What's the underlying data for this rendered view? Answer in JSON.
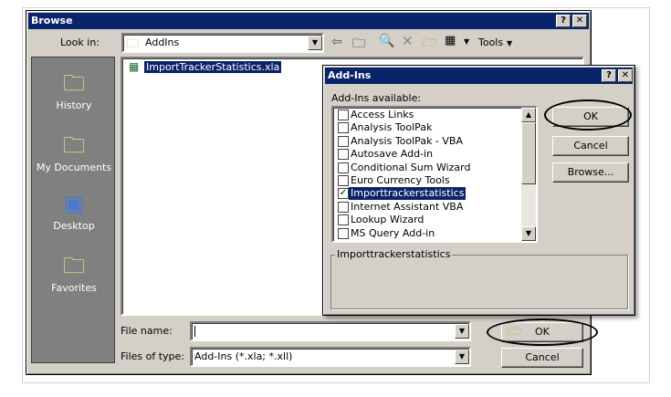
{
  "browse": {
    "title": "Browse",
    "help": "?",
    "close": "✕",
    "look_in_label": "Look in:",
    "look_in_value": "AddIns",
    "tools_label": "Tools",
    "places": [
      {
        "label": "History"
      },
      {
        "label": "My Documents"
      },
      {
        "label": "Desktop"
      },
      {
        "label": "Favorites"
      }
    ],
    "file": "ImportTrackerStatistics.xla",
    "filename_label": "File name:",
    "filename_value": "",
    "filetype_label": "Files of type:",
    "filetype_value": "Add-Ins (*.xla; *.xll)",
    "ok_label": "OK",
    "cancel_label": "Cancel"
  },
  "addins": {
    "title": "Add-Ins",
    "available_label": "Add-Ins available:",
    "items": [
      {
        "label": "Access Links",
        "checked": false
      },
      {
        "label": "Analysis ToolPak",
        "checked": false
      },
      {
        "label": "Analysis ToolPak - VBA",
        "checked": false
      },
      {
        "label": "Autosave Add-in",
        "checked": false
      },
      {
        "label": "Conditional Sum Wizard",
        "checked": false
      },
      {
        "label": "Euro Currency Tools",
        "checked": false
      },
      {
        "label": "Importtrackerstatistics",
        "checked": true
      },
      {
        "label": "Internet Assistant VBA",
        "checked": false
      },
      {
        "label": "Lookup Wizard",
        "checked": false
      },
      {
        "label": "MS Query Add-in",
        "checked": false
      }
    ],
    "selected_index": 6,
    "description_title": "Importtrackerstatistics",
    "ok_label": "OK",
    "cancel_label": "Cancel",
    "browse_label": "Browse..."
  },
  "colors": {
    "titlebar": "#0a246a",
    "face": "#d4d0c8",
    "places": "#808080"
  }
}
